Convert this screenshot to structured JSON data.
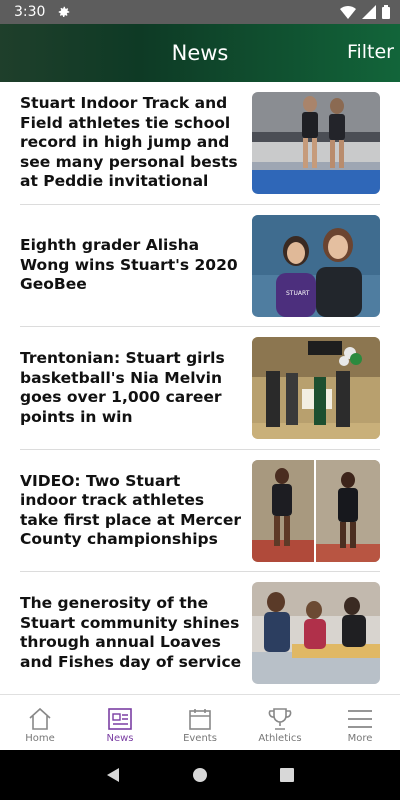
{
  "status_bar": {
    "time": "3:30"
  },
  "app_bar": {
    "title": "News",
    "filter_label": "Filter"
  },
  "news": [
    {
      "headline": "Stuart Indoor Track and Field athletes tie school record in high jump and see many personal bests at Peddie invitational",
      "thumb_icon": "track-athletes-photo"
    },
    {
      "headline": "Eighth grader Alisha Wong wins Stuart's 2020 GeoBee",
      "thumb_icon": "geobee-winner-photo"
    },
    {
      "headline": "Trentonian: Stuart girls basketball's Nia Melvin goes over 1,000 career points in win",
      "thumb_icon": "basketball-celebration-photo"
    },
    {
      "headline": "VIDEO: Two Stuart indoor track athletes take first place at Mercer County championships",
      "thumb_icon": "track-champions-photo"
    },
    {
      "headline": "The generosity of the Stuart community shines through annual Loaves and Fishes day of service",
      "thumb_icon": "day-of-service-photo"
    }
  ],
  "tabs": [
    {
      "label": "Home",
      "icon": "home-icon"
    },
    {
      "label": "News",
      "icon": "newspaper-icon",
      "active": true
    },
    {
      "label": "Events",
      "icon": "calendar-icon"
    },
    {
      "label": "Athletics",
      "icon": "trophy-icon"
    },
    {
      "label": "More",
      "icon": "menu-icon"
    }
  ],
  "colors": {
    "accent": "#7b3fa3",
    "header_dark": "#0e3a25",
    "header_light": "#12653a"
  }
}
